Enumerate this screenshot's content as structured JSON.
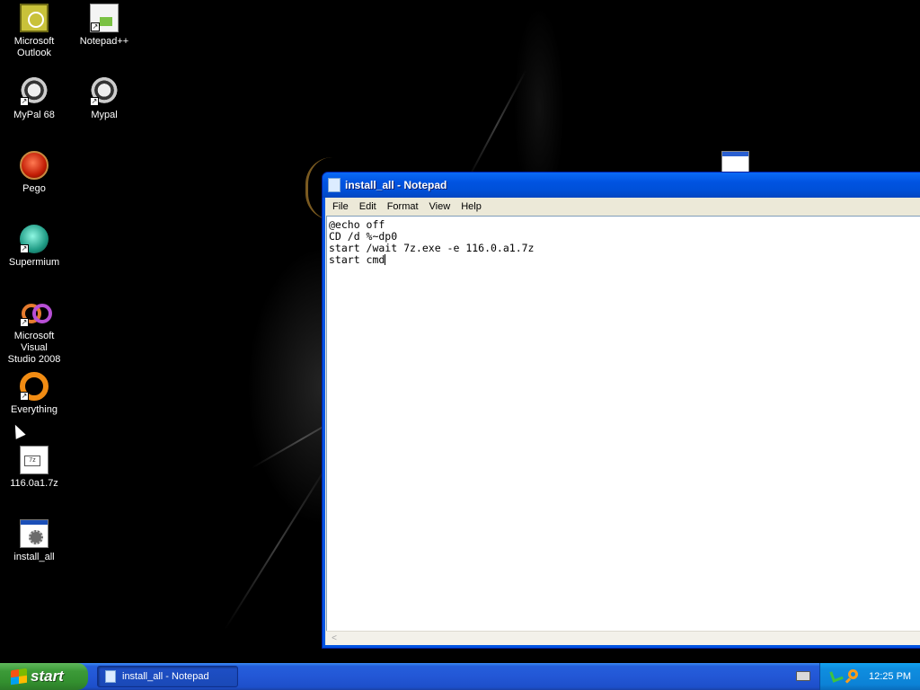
{
  "desktop": {
    "icons": [
      {
        "label_line1": "Microsoft",
        "label_line2": "Outlook",
        "icon": "outlook-icon"
      },
      {
        "label_line1": "Notepad++",
        "label_line2": "",
        "icon": "notepad-plus-plus-icon"
      },
      {
        "label_line1": "MyPal 68",
        "label_line2": "",
        "icon": "mypal-raccoon-icon"
      },
      {
        "label_line1": "Mypal",
        "label_line2": "",
        "icon": "mypal-raccoon-icon"
      },
      {
        "label_line1": "Pego",
        "label_line2": "",
        "icon": "pego-icon"
      },
      {
        "label_line1": "Supermium",
        "label_line2": "",
        "icon": "supermium-icon"
      },
      {
        "label_line1": "Microsoft Visual",
        "label_line2": "Studio 2008",
        "icon": "visual-studio-icon"
      },
      {
        "label_line1": "Everything",
        "label_line2": "",
        "icon": "everything-search-icon"
      },
      {
        "label_line1": "116.0a1.7z",
        "label_line2": "",
        "icon": "7z-archive-icon"
      },
      {
        "label_line1": "install_all",
        "label_line2": "",
        "icon": "batch-file-icon"
      }
    ]
  },
  "notepad": {
    "title": "install_all - Notepad",
    "menu": [
      "File",
      "Edit",
      "Format",
      "View",
      "Help"
    ],
    "lines": [
      "@echo off",
      "CD /d %~dp0",
      "start /wait 7z.exe -e 116.0.a1.7z",
      "start cmd"
    ]
  },
  "taskbar": {
    "start_label": "start",
    "task_label": "install_all - Notepad",
    "clock": "12:25 PM"
  },
  "colors": {
    "titlebar_blue": "#0054e3",
    "taskbar_blue": "#245edb",
    "start_green": "#3c9a38",
    "tray_blue": "#0f8ee0"
  }
}
